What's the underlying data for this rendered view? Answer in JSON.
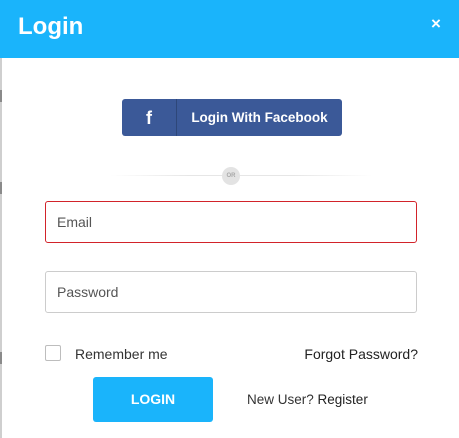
{
  "header": {
    "title": "Login",
    "close_label": "×"
  },
  "social": {
    "facebook_icon": "f",
    "facebook_label": "Login With Facebook"
  },
  "divider": {
    "label": "OR"
  },
  "form": {
    "email_placeholder": "Email",
    "email_value": "",
    "password_placeholder": "Password",
    "password_value": "",
    "remember_label": "Remember me",
    "remember_checked": false,
    "forgot_label": "Forgot Password?",
    "login_label": "LOGIN",
    "new_user_text": "New User?",
    "register_label": "Register"
  },
  "colors": {
    "header_bg": "#1ab4fb",
    "facebook_bg": "#3b5998",
    "login_bg": "#1ab4fb",
    "email_border": "#d2232a",
    "field_border": "#cccccc"
  },
  "icons": {
    "close": "close-icon",
    "facebook": "facebook-icon",
    "checkbox": "checkbox-icon"
  }
}
